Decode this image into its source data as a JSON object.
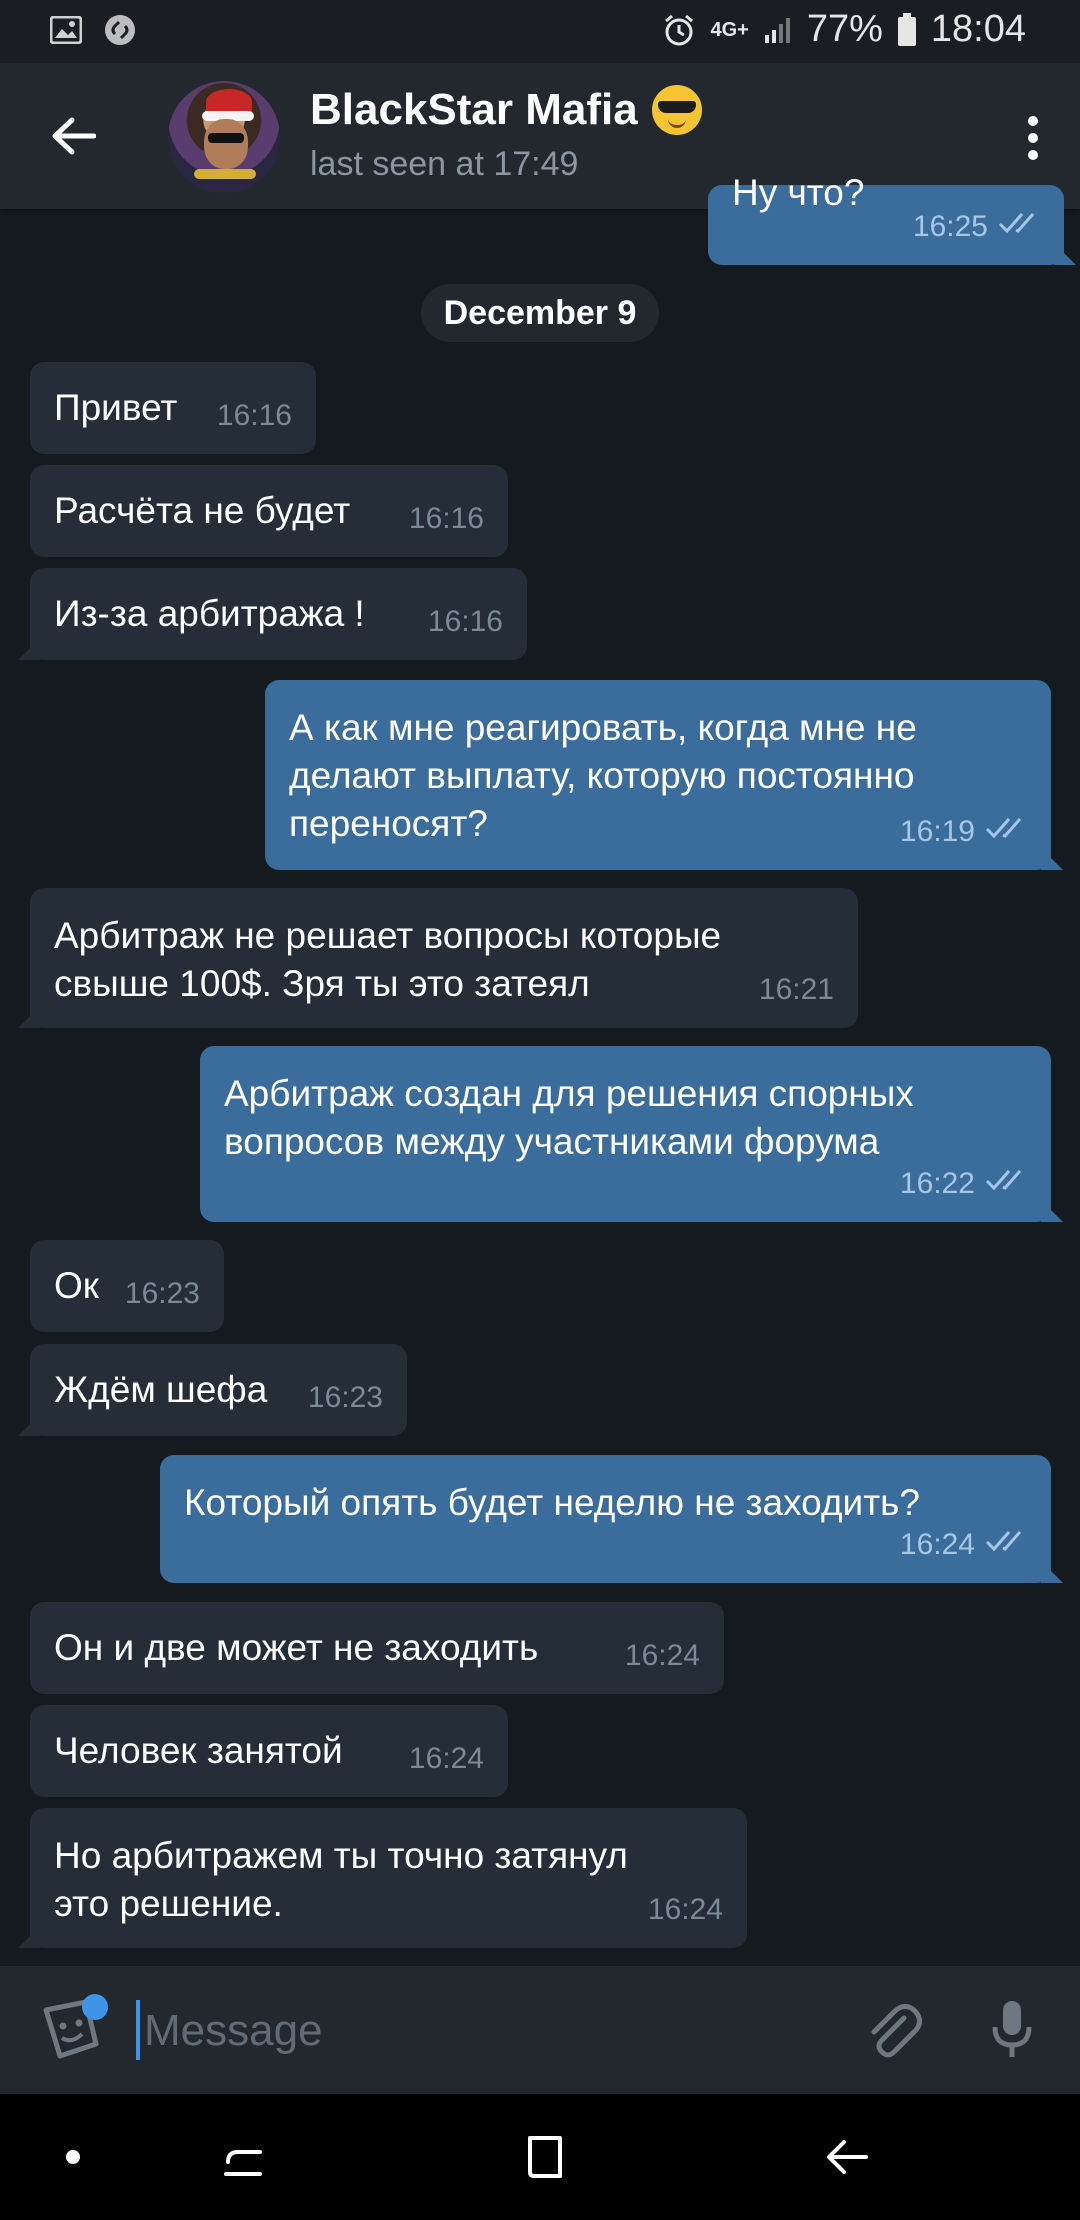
{
  "status_bar": {
    "battery": "77%",
    "time": "18:04",
    "network": "4G+",
    "icons": [
      "gallery-icon",
      "shazam-icon",
      "alarm-icon",
      "signal-icon",
      "battery-icon"
    ]
  },
  "header": {
    "title": "BlackStar Mafia",
    "status": "last seen at 17:49",
    "icons": [
      "back-arrow-icon",
      "avatar",
      "sunglasses-emoji",
      "more-vertical-icon"
    ]
  },
  "date_divider": "December 9",
  "messages": [
    {
      "dir": "out",
      "text": "Ну что?",
      "time": "16:25",
      "read": true
    },
    {
      "dir": "in",
      "text": "Привет",
      "time": "16:16"
    },
    {
      "dir": "in",
      "text": "Расчёта не будет",
      "time": "16:16"
    },
    {
      "dir": "in",
      "text": "Из-за арбитража !",
      "time": "16:16"
    },
    {
      "dir": "out",
      "text": "А как мне реагировать, когда мне не\nделают выплату, которую постоянно\nпереносят?",
      "time": "16:19",
      "read": true
    },
    {
      "dir": "in",
      "text": "Арбитраж не решает вопросы которые\nсвыше 100$. Зря ты это затеял",
      "time": "16:21"
    },
    {
      "dir": "out",
      "text": "Арбитраж создан для решения спорных\nвопросов между участниками форума",
      "time": "16:22",
      "read": true
    },
    {
      "dir": "in",
      "text": "Ок",
      "time": "16:23"
    },
    {
      "dir": "in",
      "text": "Ждём шефа",
      "time": "16:23"
    },
    {
      "dir": "out",
      "text": "Который опять будет неделю не заходить?",
      "time": "16:24",
      "read": true
    },
    {
      "dir": "in",
      "text": "Он и две может не заходить",
      "time": "16:24"
    },
    {
      "dir": "in",
      "text": "Человек занятой",
      "time": "16:24"
    },
    {
      "dir": "in",
      "text": "Но арбитражем ты точно затянул\nэто решение.",
      "time": "16:24"
    }
  ],
  "input": {
    "placeholder": "Message",
    "value": ""
  },
  "colors": {
    "background": "#151a1f",
    "header": "#23282e",
    "incoming_bubble": "#242d38",
    "outgoing_bubble": "#3a6d9c",
    "accent": "#3e95e8"
  }
}
